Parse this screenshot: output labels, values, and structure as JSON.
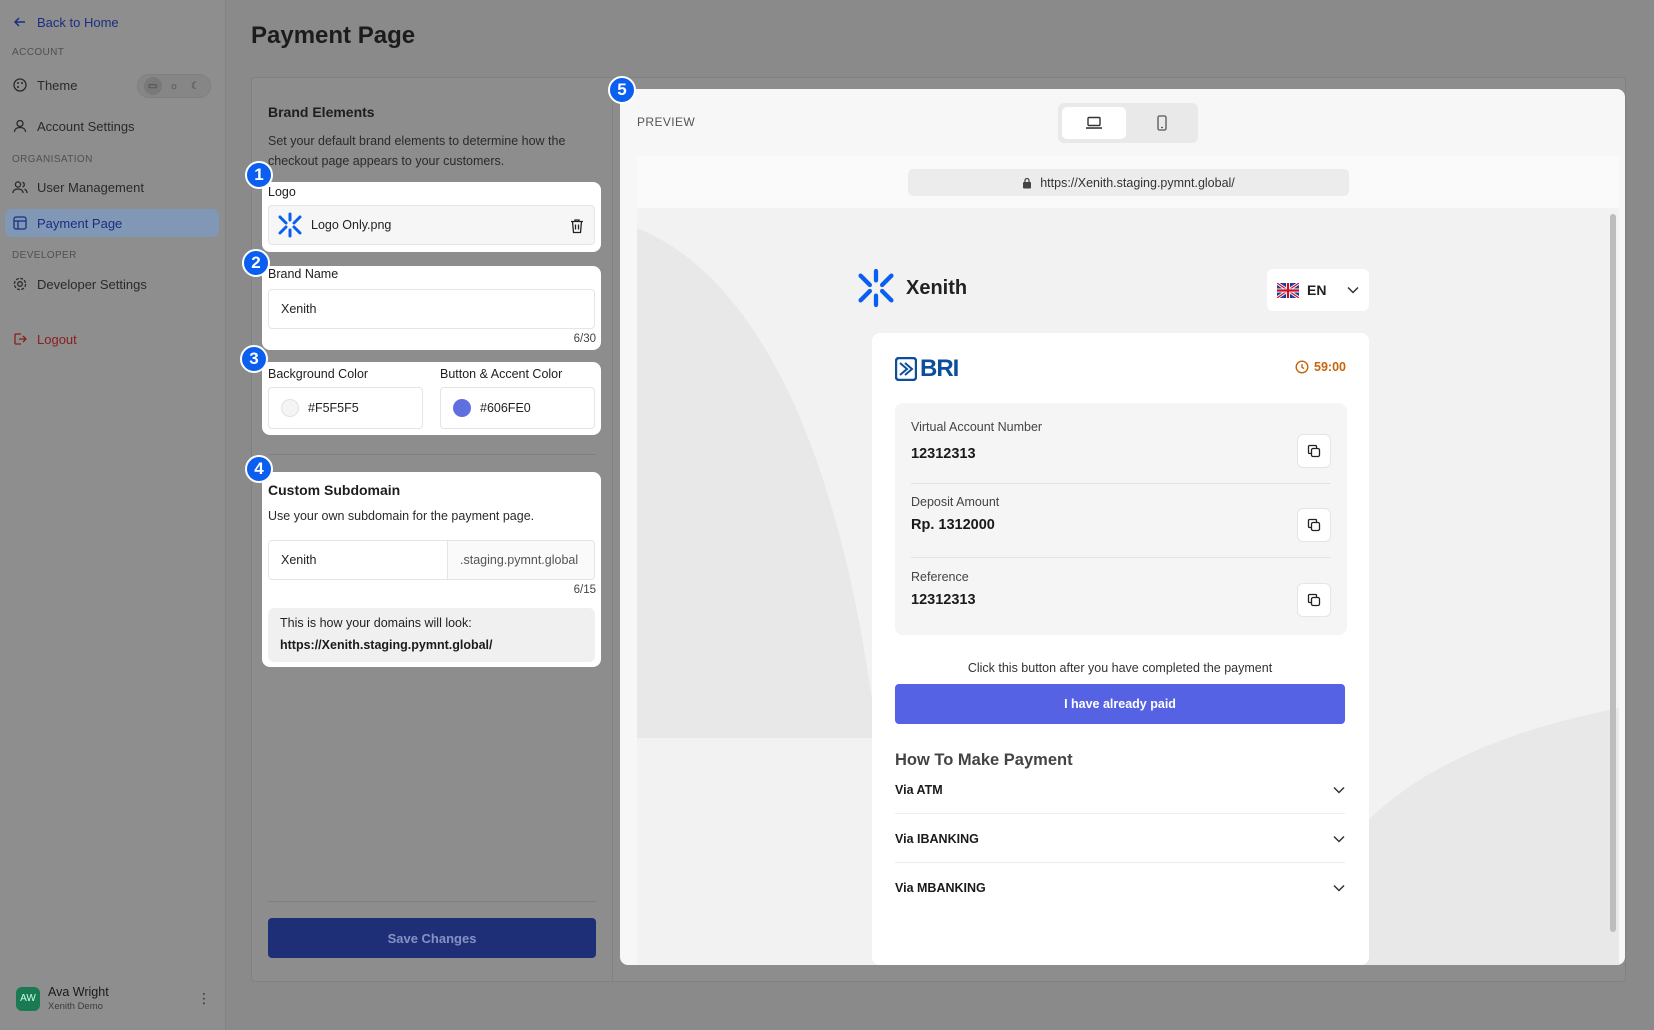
{
  "sidebar": {
    "back": "Back to Home",
    "sections": {
      "account": "ACCOUNT",
      "organisation": "ORGANISATION",
      "developer": "DEVELOPER"
    },
    "items": {
      "theme": "Theme",
      "account_settings": "Account Settings",
      "user_management": "User Management",
      "payment_page": "Payment Page",
      "developer_settings": "Developer Settings",
      "logout": "Logout"
    },
    "user": {
      "initials": "AW",
      "name": "Ava Wright",
      "org": "Xenith Demo"
    }
  },
  "page": {
    "title": "Payment Page"
  },
  "brand": {
    "title": "Brand Elements",
    "description": "Set your default brand elements to determine how the checkout page appears to your customers.",
    "logo": {
      "label": "Logo",
      "file": "Logo Only.png"
    },
    "name": {
      "label": "Brand Name",
      "value": "Xenith",
      "counter": "6/30"
    },
    "colors": {
      "bg_label": "Background Color",
      "bg_value": "#F5F5F5",
      "accent_label": "Button & Accent Color",
      "accent_value": "#606FE0"
    },
    "subdomain": {
      "title": "Custom Subdomain",
      "description": "Use your own subdomain for the payment page.",
      "value": "Xenith",
      "suffix": ".staging.pymnt.global",
      "counter": "6/15",
      "hint": "This is how your domains will look:",
      "url": "https://Xenith.staging.pymnt.global/"
    },
    "save": "Save Changes"
  },
  "badges": [
    "1",
    "2",
    "3",
    "4",
    "5"
  ],
  "preview": {
    "label": "PREVIEW",
    "url": "https://Xenith.staging.pymnt.global/",
    "brand": "Xenith",
    "lang": "EN",
    "bank": "BRI",
    "timer": "59:00",
    "fields": [
      {
        "label": "Virtual Account Number",
        "value": "12312313"
      },
      {
        "label": "Deposit Amount",
        "value": "Rp. 1312000"
      },
      {
        "label": "Reference",
        "value": "12312313"
      }
    ],
    "instruction": "Click this button after you have completed the payment",
    "paid_button": "I have already paid",
    "how_title": "How To Make Payment",
    "methods": [
      "Via ATM",
      "Via IBANKING",
      "Via MBANKING"
    ]
  },
  "colors": {
    "accent": "#606FE0",
    "brand_blue": "#0A5EF0",
    "save_button": "#1E2F78"
  }
}
